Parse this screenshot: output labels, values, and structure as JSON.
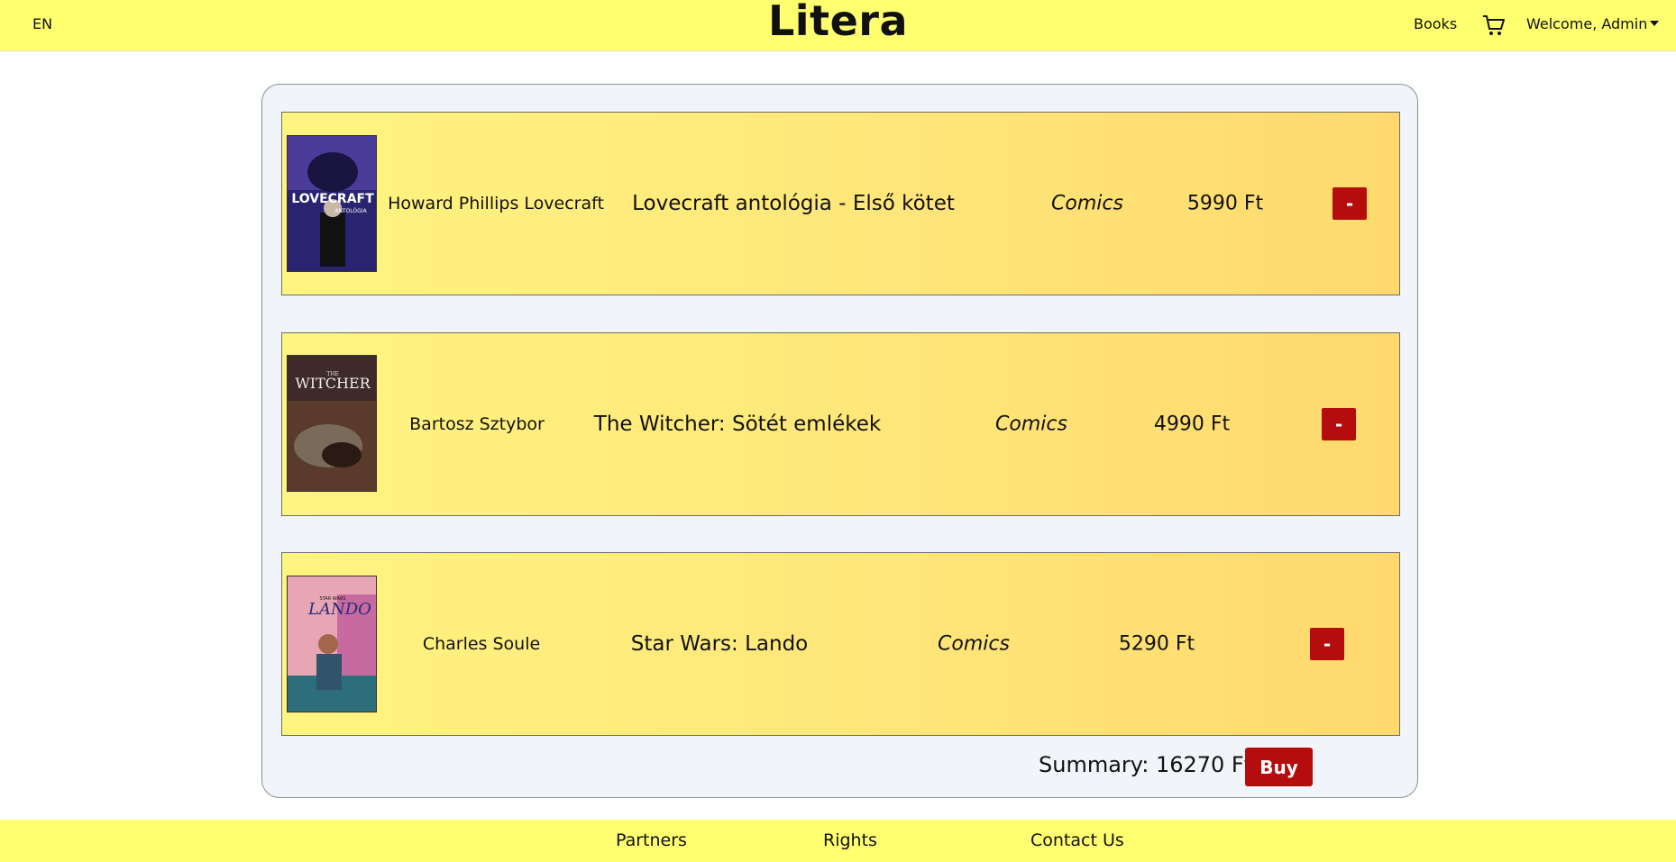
{
  "nav": {
    "language": "EN",
    "brand": "Litera",
    "books_link": "Books",
    "user_menu": "Welcome, Admin"
  },
  "cart": {
    "items": [
      {
        "author": "Howard Phillips Lovecraft",
        "title": "Lovecraft antológia - Első kötet",
        "genre": "Comics",
        "price": "5990 Ft",
        "remove_label": "-",
        "cover_text": "LOVECRAFT",
        "cover_subtext": "ANTOLÓGIA"
      },
      {
        "author": "Bartosz Sztybor",
        "title": "The Witcher: Sötét emlékek",
        "genre": "Comics",
        "price": "4990 Ft",
        "remove_label": "-",
        "cover_text": "WITCHER",
        "cover_subtext": "THE"
      },
      {
        "author": "Charles Soule",
        "title": "Star Wars: Lando",
        "genre": "Comics",
        "price": "5290 Ft",
        "remove_label": "-",
        "cover_text": "LANDO",
        "cover_subtext": "STAR WARS"
      }
    ],
    "summary": "Summary: 16270 Ft",
    "buy_label": "Buy"
  },
  "footer": {
    "partners": "Partners",
    "rights": "Rights",
    "contact": "Contact Us"
  },
  "colors": {
    "navbar_bg": "#ffff70",
    "danger": "#b50d0d",
    "panel_bg": "#f1f4f9"
  }
}
